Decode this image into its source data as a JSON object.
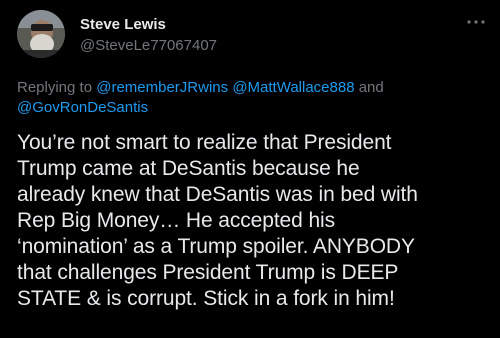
{
  "author": {
    "display_name": "Steve Lewis",
    "handle": "@SteveLe77067407",
    "avatar_icon": "profile-photo"
  },
  "more_icon": "more-dots-icon",
  "reply_context": {
    "prefix": "Replying to ",
    "mention_1": "@rememberJRwins",
    "sep_1": " ",
    "mention_2": "@MattWallace888",
    "sep_2": " and ",
    "mention_3": "@GovRonDeSantis"
  },
  "tweet_text": "You’re not smart to realize that President\nTrump came at DeSantis because he\nalready knew that DeSantis was in bed with\nRep Big Money… He accepted his\n‘nomination’ as a Trump spoiler. ANYBODY\nthat challenges President Trump  is DEEP\nSTATE & is corrupt. Stick in a fork in him!",
  "colors": {
    "background": "#000000",
    "text": "#e7e9ea",
    "secondary_text": "#71767b",
    "accent": "#1d9bf0"
  }
}
